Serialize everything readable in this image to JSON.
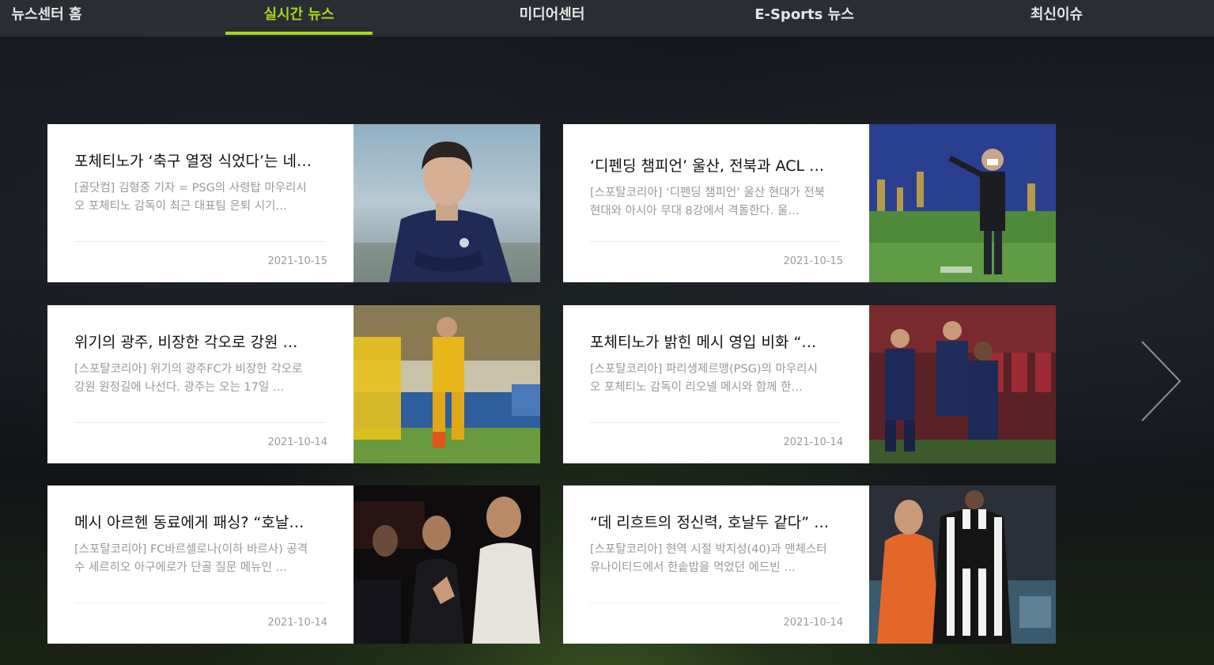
{
  "nav": {
    "items": [
      {
        "label": "뉴스센터 홈",
        "active": false
      },
      {
        "label": "실시간 뉴스",
        "active": true
      },
      {
        "label": "미디어센터",
        "active": false
      },
      {
        "label": "E-Sports 뉴스",
        "active": false
      },
      {
        "label": "최신이슈",
        "active": false
      }
    ],
    "accent_color": "#a6d61a"
  },
  "articles": [
    {
      "title": "포체티노가 ‘축구 열정 식었다’는 네…",
      "summary": "[골닷컴] 김형중 기자 = PSG의 사령탑 마우리시오 포체티노 감독이 최근 대표팀 은퇴 시기…",
      "date": "2021-10-15",
      "image": "pochettino-portrait"
    },
    {
      "title": "‘디펜딩 챔피언’ 울산, 전북과 ACL …",
      "summary": "[스포탈코리아] ‘디펜딩 챔피언’ 울산 현대가 전북현대와 아시아 무대 8강에서 격돌한다. 울…",
      "date": "2021-10-15",
      "image": "coach-pointing-stadium"
    },
    {
      "title": "위기의 광주, 비장한 각오로 강원 …",
      "summary": "[스포탈코리아] 위기의 광주FC가 비장한 각오로 강원 원정길에 나선다. 광주는 오는 17일 …",
      "date": "2021-10-14",
      "image": "gwangju-players-yellow"
    },
    {
      "title": "포체티노가 밝힌 메시 영입 비화 “…",
      "summary": "[스포탈코리아] 파리생제르맹(PSG)의 마우리시오 포체티노 감독이 리오넬 메시와 함께 한…",
      "date": "2021-10-14",
      "image": "psg-players-celebrating"
    },
    {
      "title": "메시 아르헨 동료에게 패싱? “호날…",
      "summary": "[스포탈코리아] FC바르셀로나(이하 바르사) 공격수 세르히오 아구에로가 단골 질문 메뉴인 …",
      "date": "2021-10-14",
      "image": "messi-ronaldo-ceremony"
    },
    {
      "title": "“데 리흐트의 정신력, 호날두 같다” …",
      "summary": "[스포탈코리아] 현역 시절 박지성(40)과 맨체스터 유나이티드에서 한솥밥을 먹었던 에드빈 …",
      "date": "2021-10-14",
      "image": "juventus-player-number-7"
    }
  ],
  "next_arrow": {
    "icon": "chevron-right-icon"
  }
}
